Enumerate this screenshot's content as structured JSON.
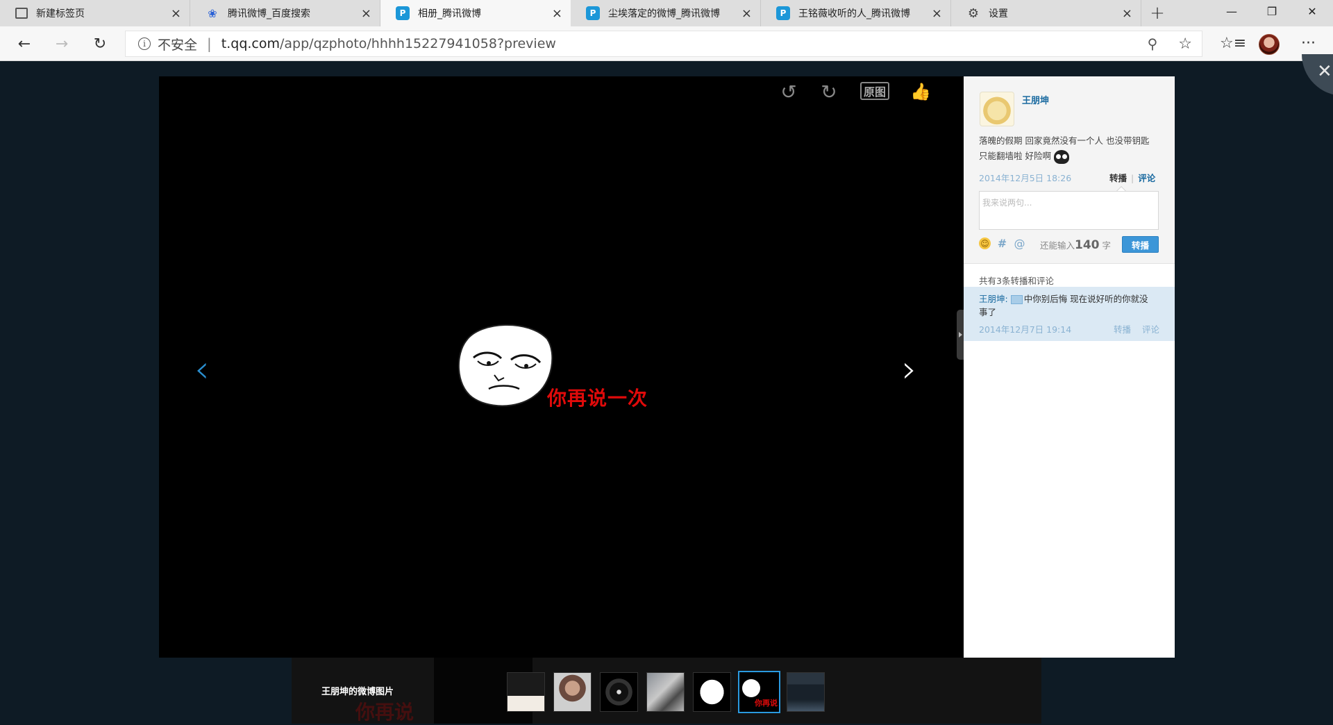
{
  "browser": {
    "tabs": [
      {
        "title": "新建标签页",
        "icon": "page-icon",
        "active": false
      },
      {
        "title": "腾讯微博_百度搜索",
        "icon": "baidu-paw-icon",
        "active": false
      },
      {
        "title": "相册_腾讯微博",
        "icon": "tencent-weibo-icon",
        "active": true
      },
      {
        "title": "尘埃落定的微博_腾讯微博",
        "icon": "tencent-weibo-icon",
        "active": false
      },
      {
        "title": "王铭薇收听的人_腾讯微博",
        "icon": "tencent-weibo-icon",
        "active": false
      },
      {
        "title": "设置",
        "icon": "gear-icon",
        "active": false
      }
    ],
    "close_glyph": "×",
    "new_tab_glyph": "+",
    "window_controls": {
      "minimize": "—",
      "maximize": "❐",
      "close": "✕"
    },
    "address": {
      "security_label": "不安全",
      "separator": "|",
      "url_host": "t.qq.com",
      "url_path": "/app/qzphoto/hhhh15227941058?preview"
    },
    "nav": {
      "back": "←",
      "forward": "→",
      "refresh": "↻"
    },
    "toolbar": {
      "zoom": "⚲",
      "favorite": "☆",
      "favorites_list": "☆≡",
      "more": "···"
    }
  },
  "viewer": {
    "tools": {
      "rotate_left": "↺",
      "rotate_right": "↻",
      "original": "原图",
      "like": "👍"
    },
    "prev_arrow": "‹",
    "next_arrow": "›",
    "image_caption": "你再说一次",
    "close": "✕"
  },
  "panel": {
    "author": "王朋坤",
    "post_text": "落魄的假期 回家竟然没有一个人 也没带钥匙 只能翻墙啦 好险啊",
    "post_date": "2014年12月5日 18:26",
    "actions": {
      "repost": "转播",
      "separator": "|",
      "comment": "评论"
    },
    "reply_placeholder": "我来说两句...",
    "remaining_prefix": "还能输入",
    "remaining_count": "140",
    "remaining_suffix": "字",
    "submit_label": "转播",
    "comment_count_text": "共有3条转播和评论",
    "comments": [
      {
        "user": "王朋坤:",
        "text": "中你别后悔 现在说好听的你就没事了",
        "date": "2014年12月7日 19:14",
        "repost": "转播",
        "comment": "评论"
      }
    ]
  },
  "filmstrip": {
    "title": "王朋坤的微博图片",
    "ghost_caption": "你再说",
    "active_thumb_caption": "你再说",
    "thumbnail_count": 7,
    "active_index": 5
  },
  "colors": {
    "accent_blue": "#3c96d8",
    "link_blue": "#1a6aa0",
    "caption_red": "#e00a0a"
  }
}
